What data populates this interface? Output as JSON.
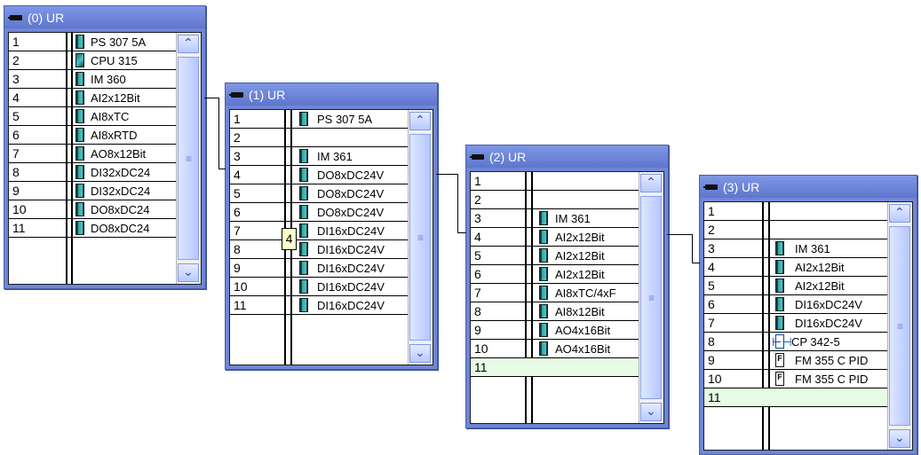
{
  "racks": [
    {
      "title": "(0) UR",
      "rows": [
        {
          "slot": "1",
          "module": "PS 307 5A",
          "icon": "module-icon"
        },
        {
          "slot": "2",
          "module": "CPU 315",
          "icon": "cpu-icon"
        },
        {
          "slot": "3",
          "module": "IM 360",
          "icon": "module-icon"
        },
        {
          "slot": "4",
          "module": "AI2x12Bit",
          "icon": "module-icon"
        },
        {
          "slot": "5",
          "module": "AI8xTC",
          "icon": "module-icon"
        },
        {
          "slot": "6",
          "module": "AI8xRTD",
          "icon": "module-icon"
        },
        {
          "slot": "7",
          "module": "AO8x12Bit",
          "icon": "module-icon"
        },
        {
          "slot": "8",
          "module": "DI32xDC24",
          "icon": "module-icon"
        },
        {
          "slot": "9",
          "module": "DI32xDC24",
          "icon": "module-icon"
        },
        {
          "slot": "10",
          "module": "DO8xDC24",
          "icon": "module-icon"
        },
        {
          "slot": "11",
          "module": "DO8xDC24",
          "icon": "module-icon"
        }
      ]
    },
    {
      "title": "(1) UR",
      "rows": [
        {
          "slot": "1",
          "module": "PS 307 5A",
          "icon": "module-icon"
        },
        {
          "slot": "2",
          "module": "",
          "icon": ""
        },
        {
          "slot": "3",
          "module": "IM 361",
          "icon": "module-icon"
        },
        {
          "slot": "4",
          "module": "DO8xDC24V",
          "icon": "module-icon"
        },
        {
          "slot": "5",
          "module": "DO8xDC24V",
          "icon": "module-icon"
        },
        {
          "slot": "6",
          "module": "DO8xDC24V",
          "icon": "module-icon"
        },
        {
          "slot": "7",
          "module": "DI16xDC24V",
          "icon": "module-icon"
        },
        {
          "slot": "8",
          "module": "DI16xDC24V",
          "icon": "module-icon"
        },
        {
          "slot": "9",
          "module": "DI16xDC24V",
          "icon": "module-icon"
        },
        {
          "slot": "10",
          "module": "DI16xDC24V",
          "icon": "module-icon"
        },
        {
          "slot": "11",
          "module": "DI16xDC24V",
          "icon": "module-icon"
        }
      ],
      "tooltip": "4"
    },
    {
      "title": "(2) UR",
      "rows": [
        {
          "slot": "1",
          "module": "",
          "icon": ""
        },
        {
          "slot": "2",
          "module": "",
          "icon": ""
        },
        {
          "slot": "3",
          "module": "IM 361",
          "icon": "module-icon"
        },
        {
          "slot": "4",
          "module": "AI2x12Bit",
          "icon": "module-icon"
        },
        {
          "slot": "5",
          "module": "AI2x12Bit",
          "icon": "module-icon"
        },
        {
          "slot": "6",
          "module": "AI2x12Bit",
          "icon": "module-icon"
        },
        {
          "slot": "7",
          "module": "AI8xTC/4xF",
          "icon": "module-icon"
        },
        {
          "slot": "8",
          "module": "AI8x12Bit",
          "icon": "module-icon"
        },
        {
          "slot": "9",
          "module": "AO4x16Bit",
          "icon": "module-icon"
        },
        {
          "slot": "10",
          "module": "AO4x16Bit",
          "icon": "module-icon"
        },
        {
          "slot": "11",
          "module": "",
          "icon": ""
        }
      ]
    },
    {
      "title": "(3) UR",
      "rows": [
        {
          "slot": "1",
          "module": "",
          "icon": ""
        },
        {
          "slot": "2",
          "module": "",
          "icon": ""
        },
        {
          "slot": "3",
          "module": "IM 361",
          "icon": "module-icon"
        },
        {
          "slot": "4",
          "module": "AI2x12Bit",
          "icon": "module-icon"
        },
        {
          "slot": "5",
          "module": "AI2x12Bit",
          "icon": "module-icon"
        },
        {
          "slot": "6",
          "module": "DI16xDC24V",
          "icon": "module-icon"
        },
        {
          "slot": "7",
          "module": "DI16xDC24V",
          "icon": "module-icon"
        },
        {
          "slot": "8",
          "module": "CP 342-5",
          "icon": "network-icon"
        },
        {
          "slot": "9",
          "module": "FM 355 C PID",
          "icon": "function-module-icon"
        },
        {
          "slot": "10",
          "module": "FM 355 C PID",
          "icon": "function-module-icon"
        },
        {
          "slot": "11",
          "module": "",
          "icon": ""
        }
      ]
    }
  ]
}
